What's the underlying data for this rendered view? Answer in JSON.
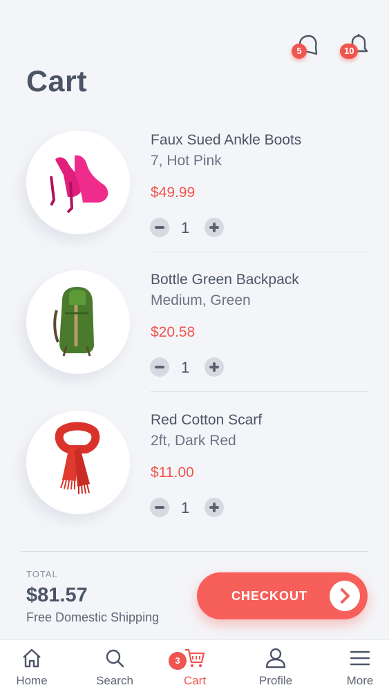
{
  "header": {
    "title": "Cart",
    "chat_badge": "5",
    "notifications_badge": "10"
  },
  "cart_items": [
    {
      "name": "Faux Sued Ankle Boots",
      "variant": "7, Hot Pink",
      "price": "$49.99",
      "quantity": "1",
      "image_icon": "pink-ankle-boots"
    },
    {
      "name": "Bottle Green Backpack",
      "variant": "Medium, Green",
      "price": "$20.58",
      "quantity": "1",
      "image_icon": "green-backpack"
    },
    {
      "name": "Red Cotton Scarf",
      "variant": "2ft, Dark Red",
      "price": "$11.00",
      "quantity": "1",
      "image_icon": "red-scarf"
    }
  ],
  "summary": {
    "total_label": "TOTAL",
    "total_value": "$81.57",
    "shipping_note": "Free Domestic Shipping",
    "checkout_label": "CHECKOUT"
  },
  "bottom_nav": {
    "cart_badge": "3",
    "items": [
      {
        "label": "Home",
        "icon": "home-icon"
      },
      {
        "label": "Search",
        "icon": "search-icon"
      },
      {
        "label": "Cart",
        "icon": "cart-icon",
        "active": true
      },
      {
        "label": "Profile",
        "icon": "profile-icon"
      },
      {
        "label": "More",
        "icon": "menu-icon"
      }
    ]
  },
  "colors": {
    "accent": "#f0554f",
    "text": "#4b5566",
    "background": "#f4f5f8"
  }
}
